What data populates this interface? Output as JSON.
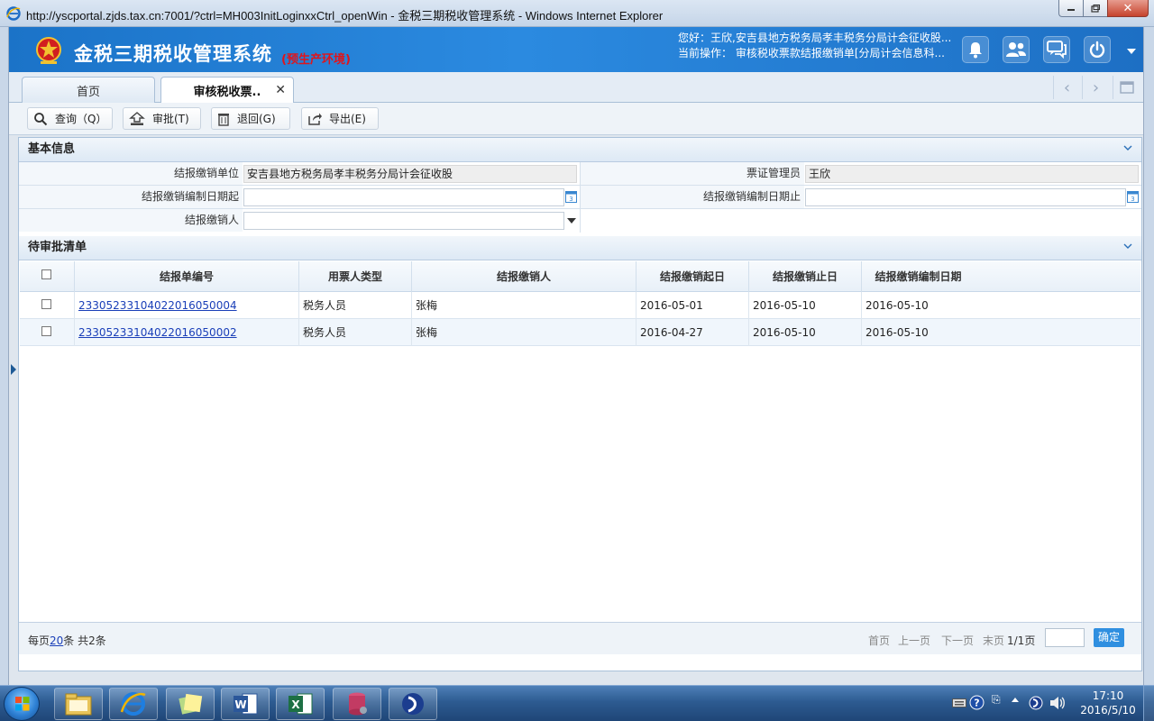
{
  "window": {
    "title": "http://yscportal.zjds.tax.cn:7001/?ctrl=MH003InitLoginxxCtrl_openWin - 金税三期税收管理系统 - Windows Internet Explorer"
  },
  "header": {
    "app_title": "金税三期税收管理系统",
    "env_label": "(预生产环境)",
    "greeting": "您好：王欣,安吉县地方税务局孝丰税务分局计会征收股...",
    "current_op": "当前操作：  审核税收票款结报缴销单[分局计会信息科..."
  },
  "tabs": [
    {
      "label": "首页"
    },
    {
      "label": "审核税收票.."
    }
  ],
  "toolbar": {
    "query": "查询（Q）",
    "approve": "审批(T)",
    "return": "退回(G)",
    "export": "导出(E)"
  },
  "basic_info": {
    "title": "基本信息",
    "unit_label": "结报缴销单位",
    "unit_value": "安吉县地方税务局孝丰税务分局计会征收股",
    "manager_label": "票证管理员",
    "manager_value": "王欣",
    "date_from_label": "结报缴销编制日期起",
    "date_from_value": "",
    "date_to_label": "结报缴销编制日期止",
    "date_to_value": "",
    "person_label": "结报缴销人",
    "person_value": ""
  },
  "pending": {
    "title": "待审批清单",
    "columns": [
      "结报单编号",
      "用票人类型",
      "结报缴销人",
      "结报缴销起日",
      "结报缴销止日",
      "结报缴销编制日期"
    ],
    "rows": [
      {
        "id": "23305233104022016050004",
        "type": "税务人员",
        "person": "张梅",
        "start": "2016-05-01",
        "end": "2016-05-10",
        "date": "2016-05-10"
      },
      {
        "id": "23305233104022016050002",
        "type": "税务人员",
        "person": "张梅",
        "start": "2016-04-27",
        "end": "2016-05-10",
        "date": "2016-05-10"
      }
    ]
  },
  "pager": {
    "per_page_prefix": "每页",
    "per_page": "20",
    "per_page_suffix": "条 共2条",
    "first": "首页",
    "prev": "上一页",
    "next": "下一页",
    "last": "末页",
    "page_info": "1/1页",
    "confirm": "确定"
  },
  "taskbar": {
    "time": "17:10",
    "date": "2016/5/10"
  },
  "colors": {
    "header_blue": "#2b8ae0",
    "env_red": "#e0141b",
    "link_blue": "#1a3fb8",
    "confirm_blue": "#2f8fe0"
  }
}
